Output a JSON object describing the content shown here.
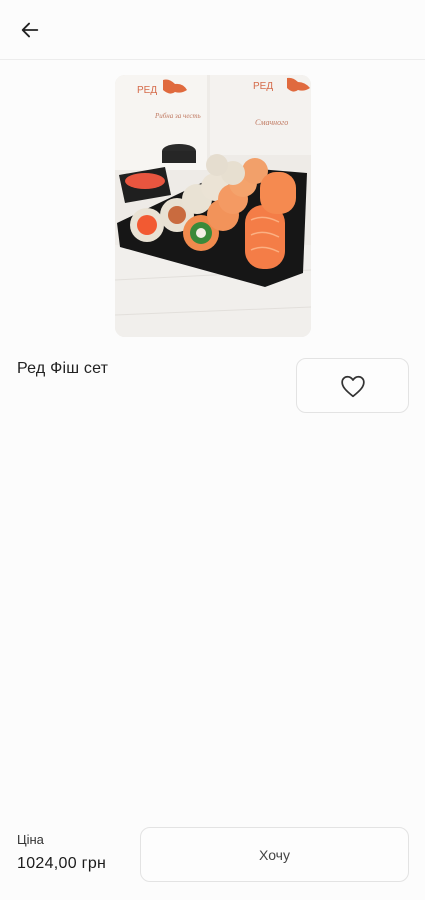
{
  "header": {
    "back_icon": "arrow-left-icon"
  },
  "product": {
    "image_icon": "sushi-set-photo",
    "title": "Ред Фіш сет",
    "favorite_icon": "heart-outline-icon"
  },
  "footer": {
    "price_label": "Ціна",
    "price_value": "1024,00 грн",
    "want_button_label": "Хочу"
  }
}
